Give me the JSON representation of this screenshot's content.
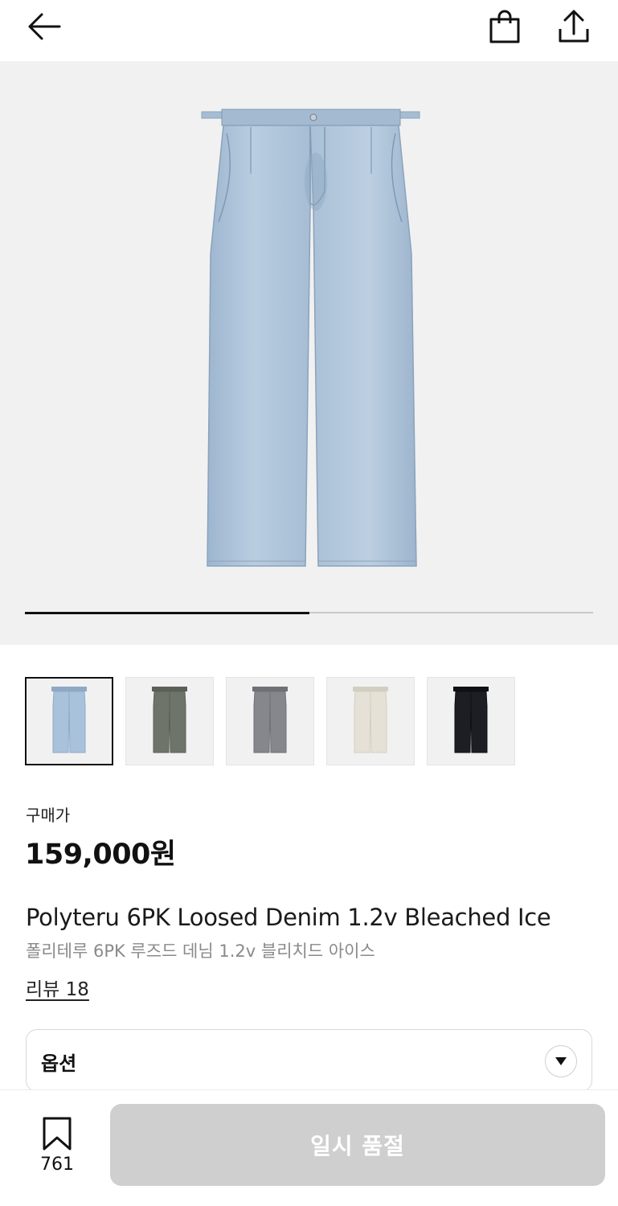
{
  "header": {
    "back_icon": "arrow-left-icon",
    "bag_icon": "shopping-bag-icon",
    "share_icon": "share-upload-icon"
  },
  "gallery": {
    "current_index": 1,
    "total": 2,
    "progress_fraction": 0.5,
    "background": "#f1f1f1"
  },
  "thumbnails": [
    {
      "color": "#a9c2dc",
      "shade": "#8fa9c4",
      "selected": true
    },
    {
      "color": "#6f746a",
      "shade": "#5b6057",
      "selected": false
    },
    {
      "color": "#85878d",
      "shade": "#6e7076",
      "selected": false
    },
    {
      "color": "#e5e1d6",
      "shade": "#d3cec2",
      "selected": false
    },
    {
      "color": "#1d1e24",
      "shade": "#0f1014",
      "selected": false
    }
  ],
  "product": {
    "price_label": "구매가",
    "price": "159,000원",
    "name_en": "Polyteru 6PK Loosed Denim 1.2v Bleached Ice",
    "name_ko": "폴리테루 6PK 루즈드 데님 1.2v 블리치드 아이스",
    "review_link": "리뷰 18"
  },
  "options": {
    "label": "옵션",
    "caret_icon": "caret-down-icon"
  },
  "bottom_bar": {
    "wish_icon": "bookmark-icon",
    "wish_count": "761",
    "cta_label": "일시 품절",
    "cta_color": "#cfcfcf"
  }
}
